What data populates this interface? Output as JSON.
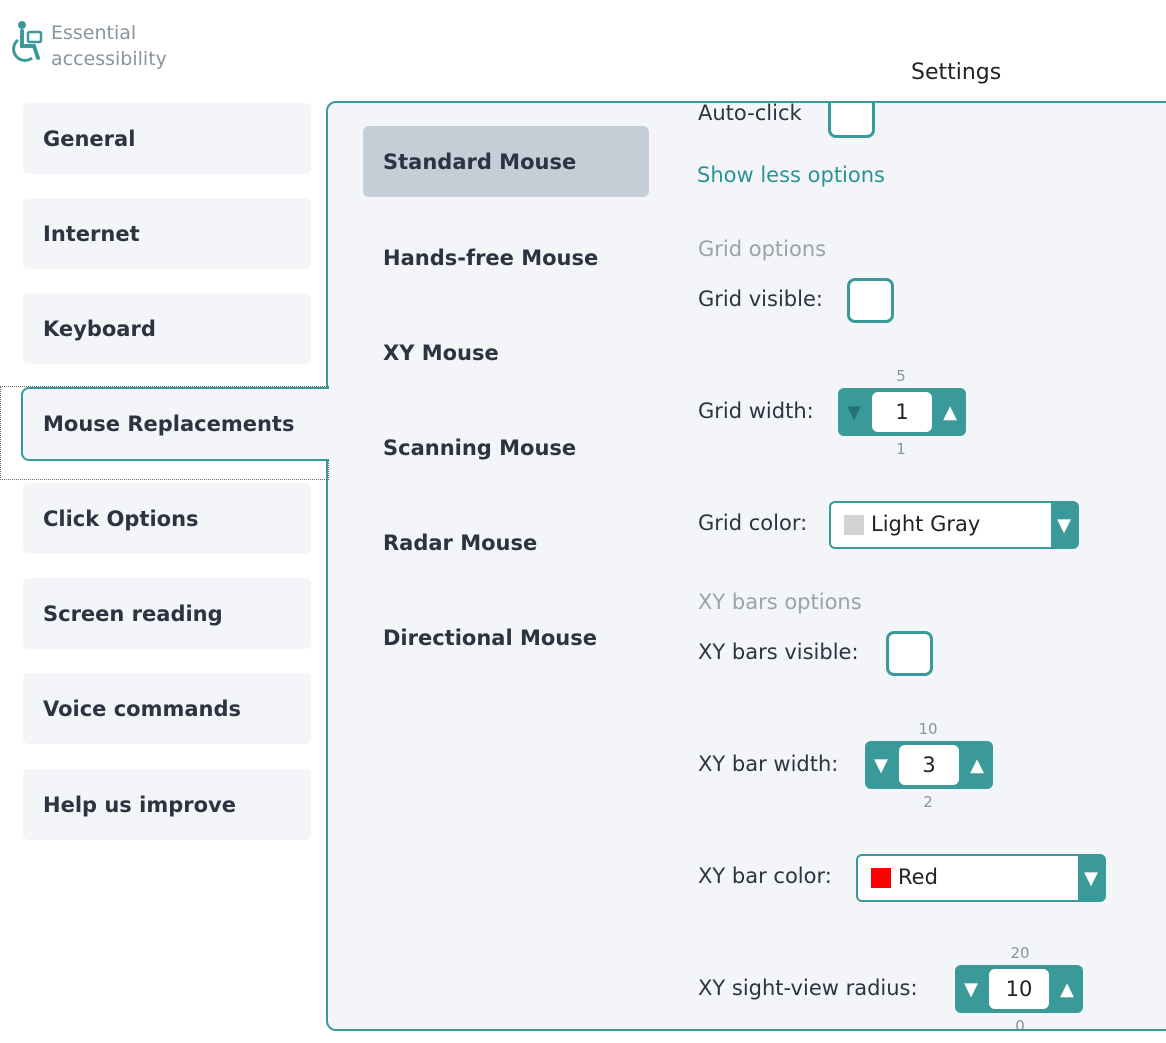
{
  "app": {
    "logo_icon": "accessibility-person-icon",
    "logo_line1": "Essential",
    "logo_line2": "accessibility",
    "settings_title": "Settings",
    "accent_color": "#3a9a9a"
  },
  "nav": {
    "items": [
      {
        "label": "General"
      },
      {
        "label": "Internet"
      },
      {
        "label": "Keyboard"
      },
      {
        "label": "Mouse Replacements"
      },
      {
        "label": "Click Options"
      },
      {
        "label": "Screen reading"
      },
      {
        "label": "Voice commands"
      },
      {
        "label": "Help us improve"
      }
    ],
    "active": "Mouse Replacements"
  },
  "submenu": {
    "items": [
      {
        "label": "Standard Mouse"
      },
      {
        "label": "Hands-free Mouse"
      },
      {
        "label": "XY Mouse"
      },
      {
        "label": "Scanning Mouse"
      },
      {
        "label": "Radar Mouse"
      },
      {
        "label": "Directional Mouse"
      }
    ],
    "active": "Standard Mouse"
  },
  "options": {
    "auto_click_label": "Auto-click",
    "show_less_link": "Show less options",
    "grid_section": "Grid options",
    "grid_visible_label": "Grid visible:",
    "grid_width": {
      "label": "Grid width:",
      "value": "1",
      "max": "5",
      "min": "1",
      "down_icon": "triangle-down-icon",
      "up_icon": "triangle-up-icon",
      "down_glyph": "▼",
      "up_glyph": "▲"
    },
    "grid_color": {
      "label": "Grid color:",
      "value": "Light Gray",
      "swatch": "#d3d3d3",
      "arrow_glyph": "▼"
    },
    "xy_section": "XY bars options",
    "xy_visible_label": "XY bars visible:",
    "xy_bar_width": {
      "label": "XY bar width:",
      "value": "3",
      "max": "10",
      "min": "2",
      "down_glyph": "▼",
      "up_glyph": "▲"
    },
    "xy_bar_color": {
      "label": "XY bar color:",
      "value": "Red",
      "swatch": "#ff0000",
      "arrow_glyph": "▼"
    },
    "xy_radius": {
      "label": "XY sight-view radius:",
      "value": "10",
      "max": "20",
      "min": "0",
      "down_glyph": "▼",
      "up_glyph": "▲"
    }
  }
}
